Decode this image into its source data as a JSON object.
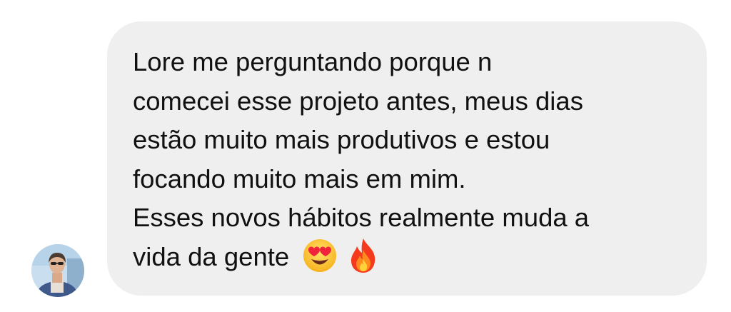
{
  "message": {
    "lines": [
      "Lore me perguntando porque n",
      "comecei esse projeto antes, meus dias",
      "estão muito mais produtivos e estou",
      "focando muito mais em mim.",
      "Esses novos hábitos realmente muda a",
      "vida da gente"
    ],
    "emojis": [
      "heart-eyes-emoji",
      "fire-emoji"
    ]
  },
  "sender": {
    "avatar": "profile-photo"
  },
  "colors": {
    "bubble_bg": "#efefef",
    "text": "#111111",
    "page_bg": "#ffffff"
  }
}
